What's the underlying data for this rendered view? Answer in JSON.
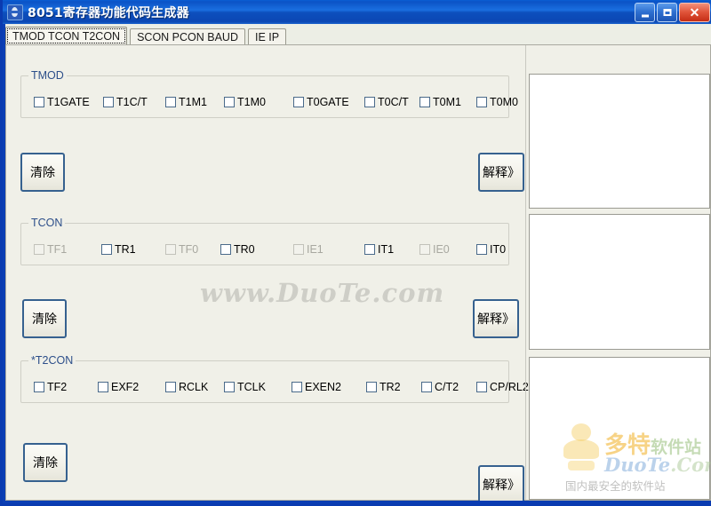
{
  "window": {
    "title": "8051寄存器功能代码生成器",
    "icon": "app-icon",
    "buttons": {
      "minimize": "_",
      "maximize": "□",
      "close": "✕"
    }
  },
  "tabs": [
    {
      "label": "TMOD TCON T2CON",
      "active": true
    },
    {
      "label": "SCON PCON BAUD",
      "active": false
    },
    {
      "label": "IE IP",
      "active": false
    }
  ],
  "sections": [
    {
      "legend": "TMOD",
      "clear_label": "清除",
      "explain_label": "解释》",
      "checkboxes": [
        {
          "label": "T1GATE",
          "checked": false,
          "disabled": false
        },
        {
          "label": "T1C/T",
          "checked": false,
          "disabled": false
        },
        {
          "label": "T1M1",
          "checked": false,
          "disabled": false
        },
        {
          "label": "T1M0",
          "checked": false,
          "disabled": false
        },
        {
          "label": "T0GATE",
          "checked": false,
          "disabled": false
        },
        {
          "label": "T0C/T",
          "checked": false,
          "disabled": false
        },
        {
          "label": "T0M1",
          "checked": false,
          "disabled": false
        },
        {
          "label": "T0M0",
          "checked": false,
          "disabled": false
        }
      ],
      "output": ""
    },
    {
      "legend": "TCON",
      "clear_label": "清除",
      "explain_label": "解释》",
      "checkboxes": [
        {
          "label": "TF1",
          "checked": false,
          "disabled": true
        },
        {
          "label": "TR1",
          "checked": false,
          "disabled": false
        },
        {
          "label": "TF0",
          "checked": false,
          "disabled": true
        },
        {
          "label": "TR0",
          "checked": false,
          "disabled": false
        },
        {
          "label": "IE1",
          "checked": false,
          "disabled": true
        },
        {
          "label": "IT1",
          "checked": false,
          "disabled": false
        },
        {
          "label": "IE0",
          "checked": false,
          "disabled": true
        },
        {
          "label": "IT0",
          "checked": false,
          "disabled": false
        }
      ],
      "output": ""
    },
    {
      "legend": "*T2CON",
      "clear_label": "清除",
      "explain_label": "解释》",
      "checkboxes": [
        {
          "label": "TF2",
          "checked": false,
          "disabled": false
        },
        {
          "label": "EXF2",
          "checked": false,
          "disabled": false
        },
        {
          "label": "RCLK",
          "checked": false,
          "disabled": false
        },
        {
          "label": "TCLK",
          "checked": false,
          "disabled": false
        },
        {
          "label": "EXEN2",
          "checked": false,
          "disabled": false
        },
        {
          "label": "TR2",
          "checked": false,
          "disabled": false
        },
        {
          "label": "C/T2",
          "checked": false,
          "disabled": false
        },
        {
          "label": "CP/RL2",
          "checked": false,
          "disabled": false
        }
      ],
      "output": ""
    }
  ],
  "watermarks": {
    "center": "www.DuoTe.com",
    "logo_main": "多特",
    "logo_main_suffix": "软件站",
    "logo_sub": "DuoTe",
    "logo_sub_com": ".Com",
    "logo_tagline": "国内最安全的软件站"
  },
  "colors": {
    "titlebar": "#0b53c6",
    "client": "#f0f0e8",
    "legend_text": "#2d4f8a",
    "border": "#cfcfc6",
    "default_button_border": "#36618f"
  }
}
